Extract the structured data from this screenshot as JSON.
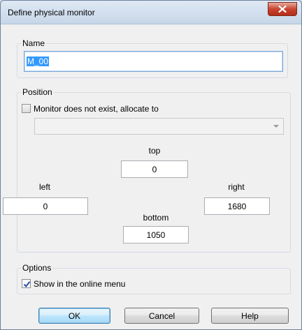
{
  "window": {
    "title": "Define physical monitor",
    "close_icon": "close-icon"
  },
  "name_group": {
    "label": "Name",
    "value": "M_00"
  },
  "position_group": {
    "label": "Position",
    "allocate_checkbox": {
      "label": "Monitor does not exist, allocate to",
      "checked": false
    },
    "allocate_select": {
      "value": ""
    },
    "top": {
      "label": "top",
      "value": "0"
    },
    "left": {
      "label": "left",
      "value": "0"
    },
    "right": {
      "label": "right",
      "value": "1680"
    },
    "bottom": {
      "label": "bottom",
      "value": "1050"
    }
  },
  "options_group": {
    "label": "Options",
    "online_menu_checkbox": {
      "label": "Show in the online menu",
      "checked": true
    }
  },
  "buttons": {
    "ok": "OK",
    "cancel": "Cancel",
    "help": "Help"
  },
  "colors": {
    "close_button": "#c7442f",
    "selection": "#3399ff",
    "default_button_border": "#3c7fb1"
  }
}
